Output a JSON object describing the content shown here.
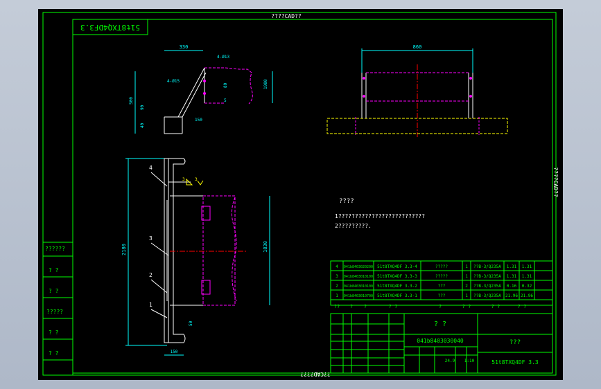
{
  "drawing": {
    "top_watermark": "????CAD??",
    "bottom_watermark": "??CAD????",
    "right_watermark": "????CAD??",
    "code_box": "51t8TXQ4DF3.3",
    "notes_title": "????",
    "notes_line1": "1??????????????????????????",
    "notes_line2": "2?????????."
  },
  "dimensions": {
    "top_width": "330",
    "holes_top": "4-Ø13",
    "holes_side": "4-Ø15",
    "h1": "90",
    "h2": "1980",
    "h3": "5",
    "h4": "40",
    "h5": "80",
    "h6": "500",
    "h7": "150",
    "plan_width": "860",
    "overall_height": "2180",
    "inner_height": "1830",
    "bottom_width": "150",
    "flange": "50"
  },
  "callouts": [
    "4",
    "3",
    "2",
    "1"
  ],
  "weld": {
    "left": "3",
    "right": "3"
  },
  "left_strip": [
    "??????",
    "? ?",
    "? ?",
    "?????",
    "? ?",
    "? ?"
  ],
  "bom": {
    "rows": [
      [
        "4",
        "041b8403020200",
        "51t8TXQ4DF 3.3-4",
        "?????",
        "1",
        "??B-3/Q235A",
        "1.31",
        "1.31"
      ],
      [
        "3",
        "041b8403010100",
        "51t8TXQ4DF 3.3-3",
        "?????",
        "1",
        "??B-3/Q235A",
        "1.31",
        "1.31"
      ],
      [
        "2",
        "041b8403010100",
        "51t8TXQ4DF 3.3-2",
        "???",
        "2",
        "??B-3/Q235A",
        "0.16",
        "0.32"
      ],
      [
        "1",
        "041b8403010700",
        "51t8TXQ4DF 3.3-1",
        "???",
        "1",
        "??B-3/Q235A",
        "21.96",
        "21.96"
      ]
    ],
    "header": [
      "??",
      "?",
      "?",
      "? ?",
      "?",
      "? ?",
      "? ?",
      "? ?"
    ]
  },
  "title_block": {
    "name": "? ?",
    "drawing_no": "041b8403030040",
    "material": "???",
    "code": "51t8TXQ4DF 3.3",
    "weight": "24.9",
    "scale": "1:10"
  },
  "colors": {
    "frame": "#00ff00",
    "geometry": "#ffffff",
    "dimension": "#00ffff",
    "hidden": "#ff00ff",
    "yellow": "#ffff00",
    "centerline": "#ff0000"
  }
}
